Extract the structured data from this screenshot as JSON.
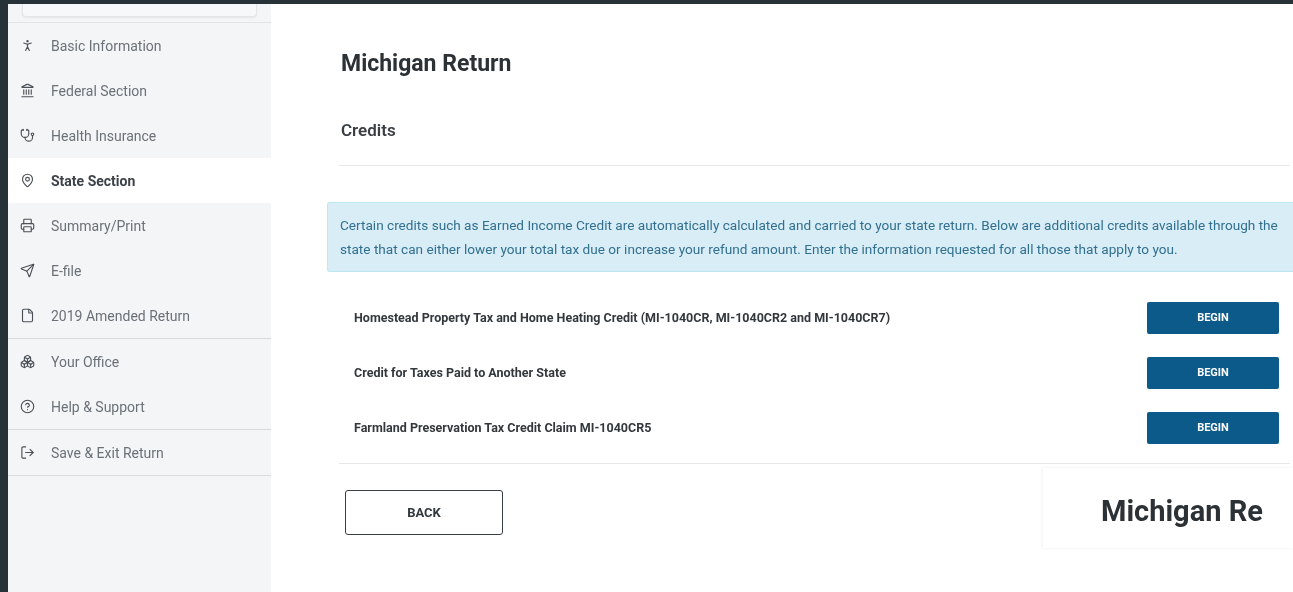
{
  "sidebar": {
    "items": [
      {
        "label": "Basic Information",
        "selected": false,
        "divider_after": false
      },
      {
        "label": "Federal Section",
        "selected": false,
        "divider_after": false
      },
      {
        "label": "Health Insurance",
        "selected": false,
        "divider_after": false
      },
      {
        "label": "State Section",
        "selected": true,
        "divider_after": false
      },
      {
        "label": "Summary/Print",
        "selected": false,
        "divider_after": false
      },
      {
        "label": "E-file",
        "selected": false,
        "divider_after": false
      },
      {
        "label": "2019 Amended Return",
        "selected": false,
        "divider_after": true
      },
      {
        "label": "Your Office",
        "selected": false,
        "divider_after": false
      },
      {
        "label": "Help & Support",
        "selected": false,
        "divider_after": true
      },
      {
        "label": "Save & Exit Return",
        "selected": false,
        "divider_after": true
      }
    ]
  },
  "main": {
    "title": "Michigan Return",
    "section": "Credits",
    "info": "Certain credits such as Earned Income Credit are automatically calculated and carried to your state return. Below are additional credits available through the state that can either lower your total tax due or increase your refund amount. Enter the information requested for all those that apply to you.",
    "credits": [
      {
        "label": "Homestead Property Tax and Home Heating Credit (MI-1040CR, MI-1040CR2 and MI-1040CR7)",
        "button": "BEGIN"
      },
      {
        "label": "Credit for Taxes Paid to Another State",
        "button": "BEGIN"
      },
      {
        "label": "Farmland Preservation Tax Credit Claim MI-1040CR5",
        "button": "BEGIN"
      }
    ],
    "back_button": "BACK",
    "next_card_title": "Michigan Re"
  }
}
